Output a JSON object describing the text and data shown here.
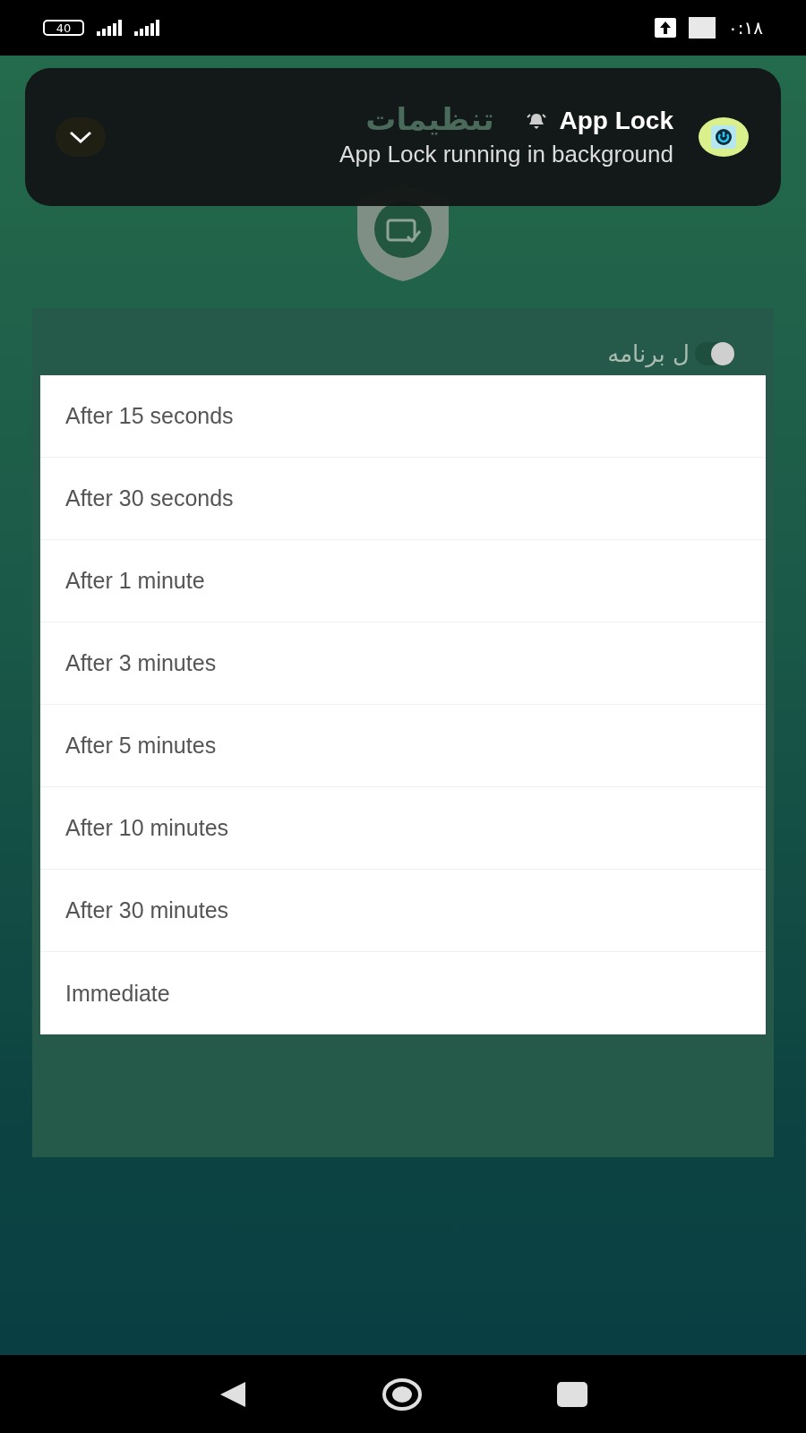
{
  "status_bar": {
    "battery": "40",
    "time": "۰:۱۸"
  },
  "notification": {
    "app_name": "App Lock",
    "message": "App Lock running in background"
  },
  "background": {
    "title": "تنظیمات",
    "setting_label": "ل برنامه",
    "toggle_on": true
  },
  "dialog": {
    "options": [
      {
        "label": "After 15 seconds"
      },
      {
        "label": "After 30 seconds"
      },
      {
        "label": "After 1 minute"
      },
      {
        "label": "After 3 minutes"
      },
      {
        "label": "After 5 minutes"
      },
      {
        "label": "After 10 minutes"
      },
      {
        "label": "After 30 minutes"
      },
      {
        "label": "Immediate"
      }
    ]
  }
}
